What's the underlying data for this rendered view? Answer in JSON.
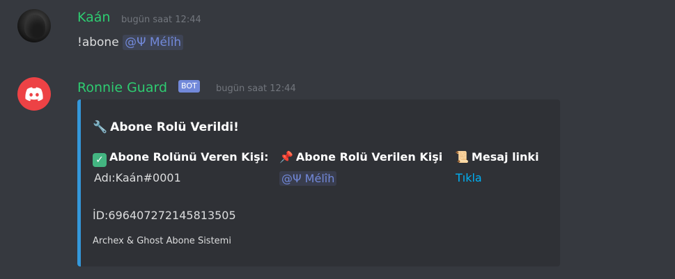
{
  "messages": [
    {
      "author": "Kaán",
      "timestamp": "bugün saat 12:44",
      "text_prefix": "!abone",
      "mention": "@Ψ Mélîh"
    },
    {
      "author": "Ronnie Guard",
      "bot_tag": "BOT",
      "timestamp": "bugün saat 12:44",
      "embed": {
        "accent_color": "#3498db",
        "title_icon": "🔧",
        "title": "Abone Rolü Verildi!",
        "fields": [
          {
            "icon": "✓",
            "name": "Abone Rolünü Veren Kişi:",
            "value": "Adı:Kaán#0001"
          },
          {
            "icon": "📌",
            "name": "Abone Rolü Verilen Kişi",
            "value": "@Ψ Mélîh"
          },
          {
            "icon": "📜",
            "name": "Mesaj linki",
            "value": "Tıkla"
          }
        ],
        "description": "İD:696407272145813505",
        "footer": "Archex & Ghost Abone Sistemi"
      }
    }
  ],
  "colors": {
    "background": "#36393f",
    "username": "#2ecc71",
    "mention_text": "#7289da",
    "link": "#00b0f4",
    "bot_tag_bg": "#7289da",
    "discord_red": "#ed4245"
  },
  "icons": {
    "user_avatar": "hooded-figure-avatar",
    "bot_avatar": "discord-logo-icon"
  }
}
